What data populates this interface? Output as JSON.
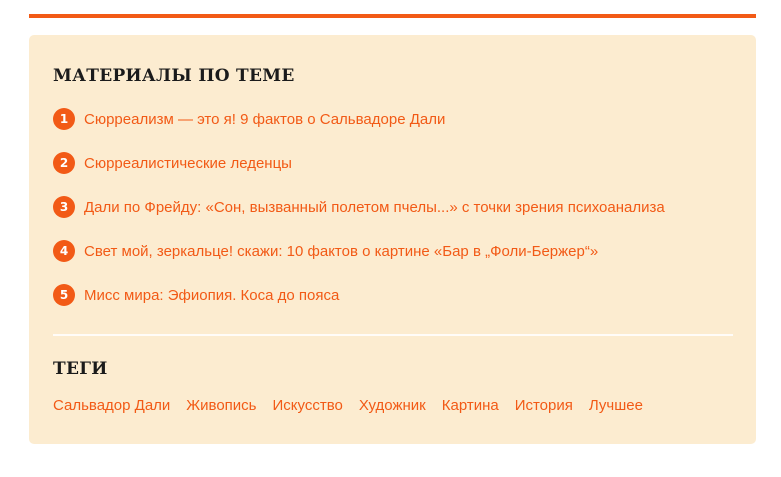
{
  "colors": {
    "accent": "#f25a16",
    "panel_background": "#fcecd0",
    "heading": "#1b1b1b"
  },
  "related": {
    "title": "МАТЕРИАЛЫ ПО ТЕМЕ",
    "items": [
      {
        "number": "1",
        "title": "Сюрреализм — это я! 9 фактов о Сальвадоре Дали"
      },
      {
        "number": "2",
        "title": "Сюрреалистические леденцы"
      },
      {
        "number": "3",
        "title": "Дали по Фрейду: «Сон, вызванный полетом пчелы...» с точки зрения психоанализа"
      },
      {
        "number": "4",
        "title": "Свет мой, зеркальце! скажи: 10 фактов о картине «Бар в „Фоли-Бержер“»"
      },
      {
        "number": "5",
        "title": "Мисс мира: Эфиопия. Коса до пояса"
      }
    ]
  },
  "tags": {
    "title": "ТЕГИ",
    "items": [
      "Сальвадор Дали",
      "Живопись",
      "Искусство",
      "Художник",
      "Картина",
      "История",
      "Лучшее"
    ]
  }
}
